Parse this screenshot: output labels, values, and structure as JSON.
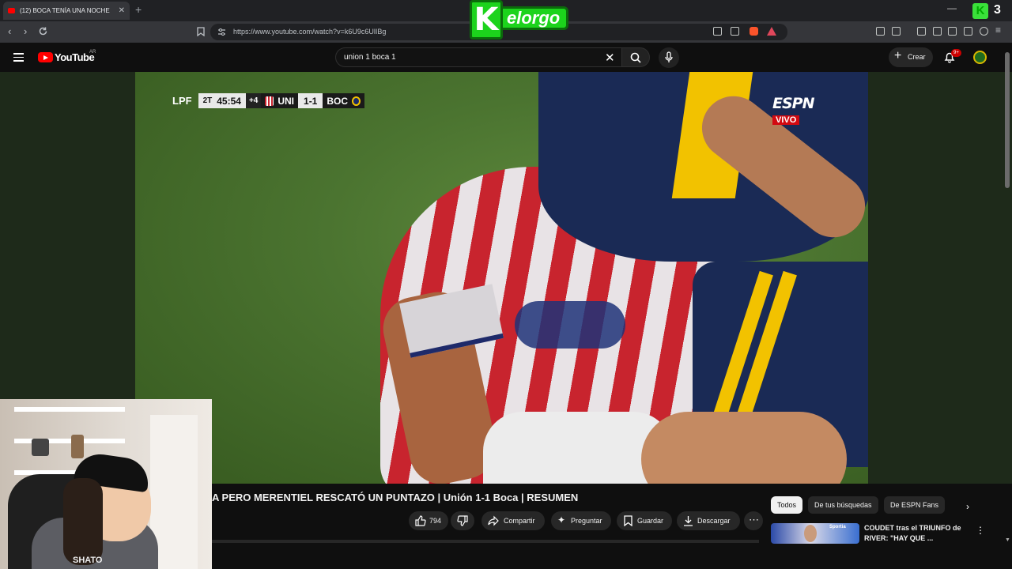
{
  "browser": {
    "tab_title": "(12) BOCA TENÍA UNA NOCHE",
    "tab_close": "✕",
    "new_tab": "+",
    "url": "https://www.youtube.com/watch?v=k6U9c6UlIBg",
    "minimize": "—",
    "overlay_count": "3"
  },
  "overlay": {
    "logo_letter": "K",
    "logo_word": "elorgo"
  },
  "youtube": {
    "logo_text": "YouTube",
    "country": "AR",
    "search_value": "union 1 boca 1",
    "search_clear": "✕",
    "create_label": "Crear",
    "notifications_badge": "9+"
  },
  "video": {
    "scorebug": {
      "league": "LPF",
      "half": "2T",
      "clock": "45:54",
      "added_time": "+4",
      "home": "UNI",
      "score": "1-1",
      "away": "BOC"
    },
    "broadcaster": "ESPN",
    "live_label": "VIVO",
    "title": "A PERO MERENTIEL RESCATÓ UN PUNTAZO | Unión 1-1 Boca | RESUMEN",
    "likes": "794",
    "share_label": "Compartir",
    "ask_label": "Preguntar",
    "save_label": "Guardar",
    "download_label": "Descargar",
    "more_label": "⋯"
  },
  "sidebar": {
    "chips": [
      "Todos",
      "De tus búsquedas",
      "De ESPN Fans"
    ],
    "related_title": "COUDET tras el TRIUNFO de RIVER: \"HAY QUE ...",
    "related_thumb_text": "Sportia"
  },
  "webcam": {
    "shirt_text": "SHATO"
  },
  "colors": {
    "youtube_red": "#ff0000",
    "espn_red": "#d20a11",
    "kelorgo_green": "#1cd31c",
    "page_bg": "#0f0f0f"
  },
  "icons": {
    "back": "chevron-left-icon",
    "forward": "chevron-right-icon",
    "reload": "reload-icon",
    "bookmark": "bookmark-icon",
    "search": "search-icon",
    "mic": "microphone-icon",
    "bell": "bell-icon",
    "like": "thumbs-up-icon",
    "dislike": "thumbs-down-icon",
    "share": "share-icon",
    "ask": "sparkle-icon",
    "save": "bookmark-icon",
    "download": "download-icon"
  }
}
